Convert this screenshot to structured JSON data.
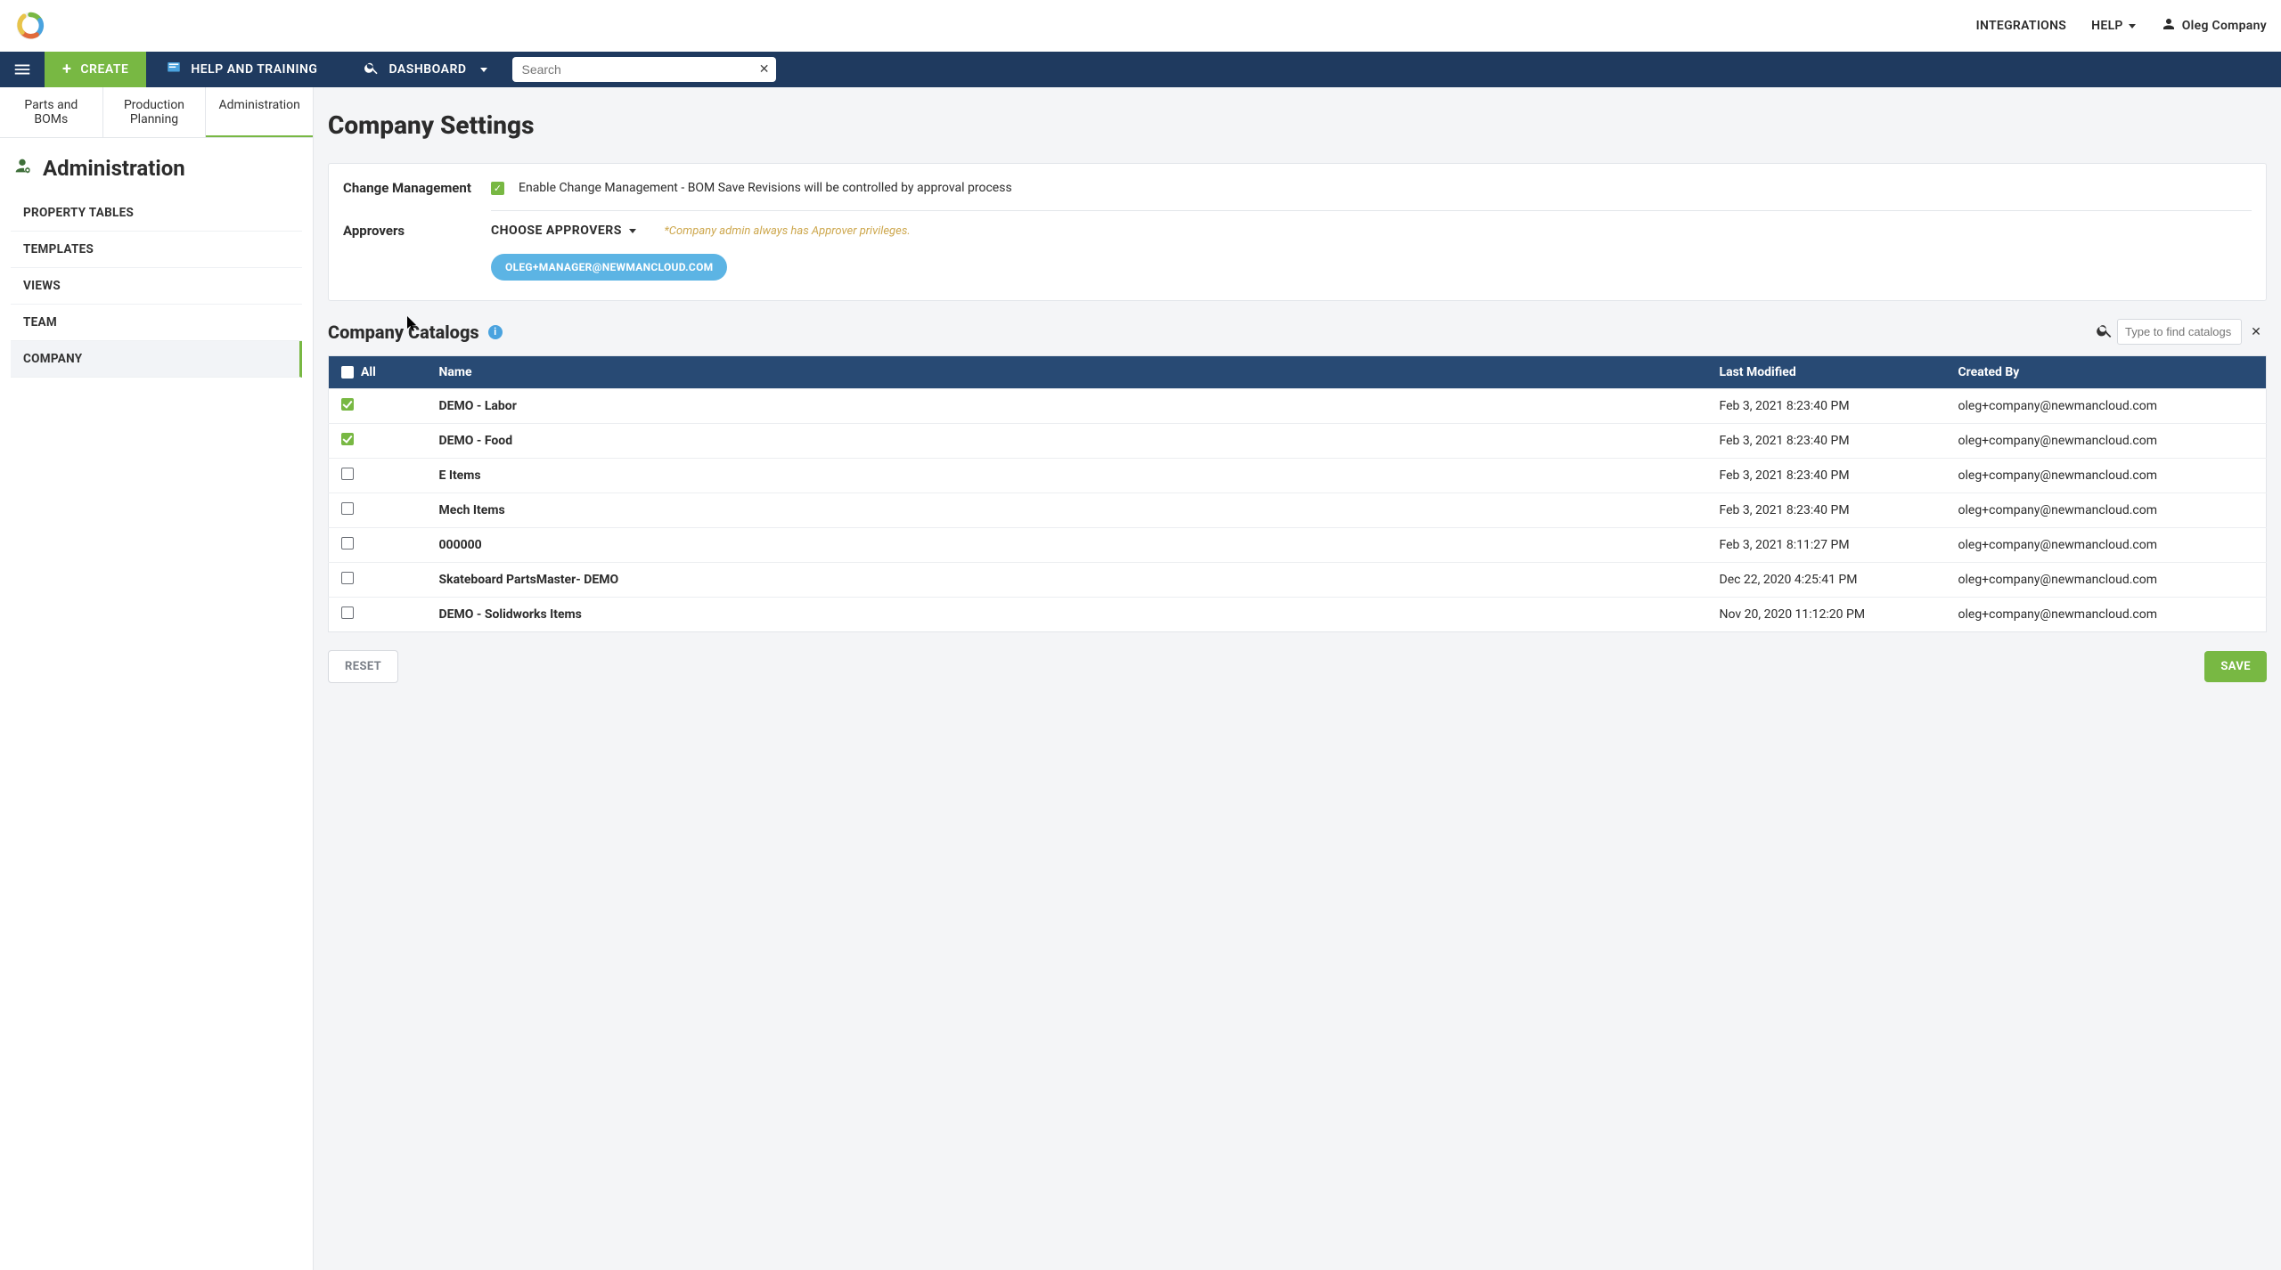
{
  "top": {
    "integrations": "INTEGRATIONS",
    "help": "HELP",
    "user": "Oleg Company"
  },
  "nav": {
    "create": "CREATE",
    "helpTraining": "HELP AND TRAINING",
    "dashboard": "DASHBOARD",
    "search_placeholder": "Search"
  },
  "subtabs": {
    "parts": "Parts and BOMs",
    "planning": "Production\nPlanning",
    "admin": "Administration"
  },
  "sidebar": {
    "title": "Administration",
    "items": [
      "PROPERTY TABLES",
      "TEMPLATES",
      "VIEWS",
      "TEAM",
      "COMPANY"
    ]
  },
  "page": {
    "title": "Company Settings",
    "changeMgmt": {
      "label": "Change Management",
      "checkbox_label": "Enable Change Management - BOM Save Revisions will be controlled by approval process"
    },
    "approvers": {
      "label": "Approvers",
      "button": "CHOOSE APPROVERS",
      "hint": "*Company admin always has Approver privileges.",
      "chip": "OLEG+MANAGER@NEWMANCLOUD.COM"
    }
  },
  "catalogs": {
    "title": "Company Catalogs",
    "search_placeholder": "Type to find catalogs",
    "all_label": "All",
    "columns": {
      "name": "Name",
      "modified": "Last Modified",
      "createdBy": "Created By"
    },
    "rows": [
      {
        "checked": true,
        "name": "DEMO - Labor",
        "modified": "Feb 3, 2021 8:23:40 PM",
        "createdBy": "oleg+company@newmancloud.com"
      },
      {
        "checked": true,
        "name": "DEMO - Food",
        "modified": "Feb 3, 2021 8:23:40 PM",
        "createdBy": "oleg+company@newmancloud.com"
      },
      {
        "checked": false,
        "name": "E Items",
        "modified": "Feb 3, 2021 8:23:40 PM",
        "createdBy": "oleg+company@newmancloud.com"
      },
      {
        "checked": false,
        "name": "Mech Items",
        "modified": "Feb 3, 2021 8:23:40 PM",
        "createdBy": "oleg+company@newmancloud.com"
      },
      {
        "checked": false,
        "name": "000000",
        "modified": "Feb 3, 2021 8:11:27 PM",
        "createdBy": "oleg+company@newmancloud.com"
      },
      {
        "checked": false,
        "name": "Skateboard PartsMaster- DEMO",
        "modified": "Dec 22, 2020 4:25:41 PM",
        "createdBy": "oleg+company@newmancloud.com"
      },
      {
        "checked": false,
        "name": "DEMO - Solidworks Items",
        "modified": "Nov 20, 2020 11:12:20 PM",
        "createdBy": "oleg+company@newmancloud.com"
      }
    ]
  },
  "footer": {
    "reset": "RESET",
    "save": "SAVE"
  }
}
